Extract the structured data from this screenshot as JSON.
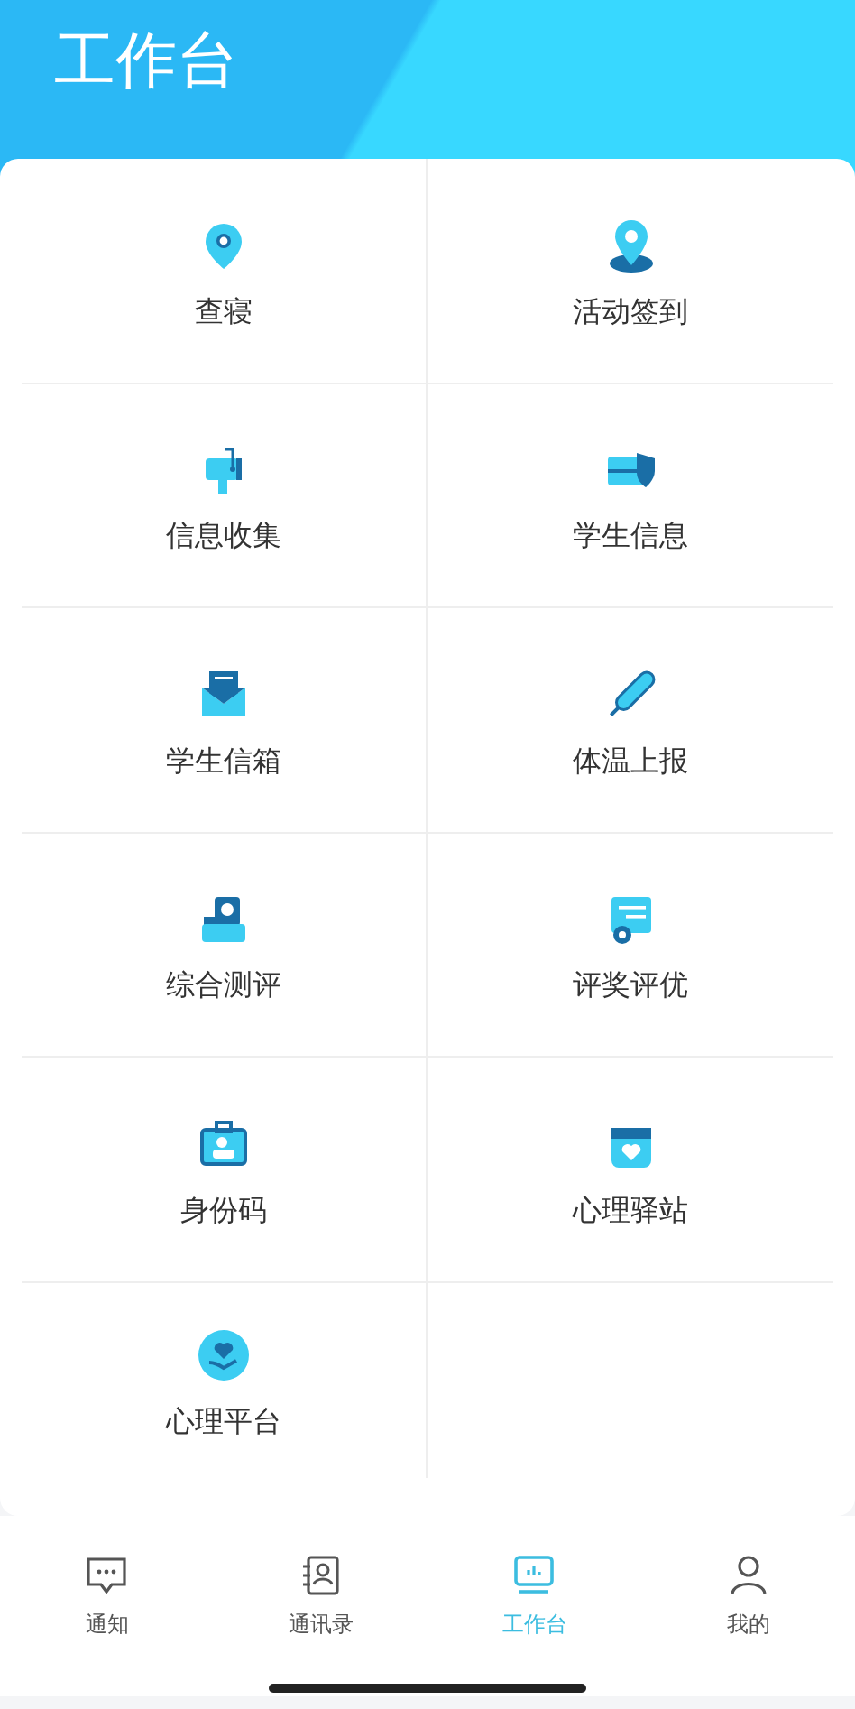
{
  "header": {
    "title": "工作台"
  },
  "apps": [
    {
      "label": "查寝"
    },
    {
      "label": "活动签到"
    },
    {
      "label": "信息收集"
    },
    {
      "label": "学生信息"
    },
    {
      "label": "学生信箱"
    },
    {
      "label": "体温上报"
    },
    {
      "label": "综合测评"
    },
    {
      "label": "评奖评优"
    },
    {
      "label": "身份码"
    },
    {
      "label": "心理驿站"
    },
    {
      "label": "心理平台"
    }
  ],
  "tabs": [
    {
      "label": "通知",
      "selected": false
    },
    {
      "label": "通讯录",
      "selected": false
    },
    {
      "label": "工作台",
      "selected": true
    },
    {
      "label": "我的",
      "selected": false
    }
  ]
}
